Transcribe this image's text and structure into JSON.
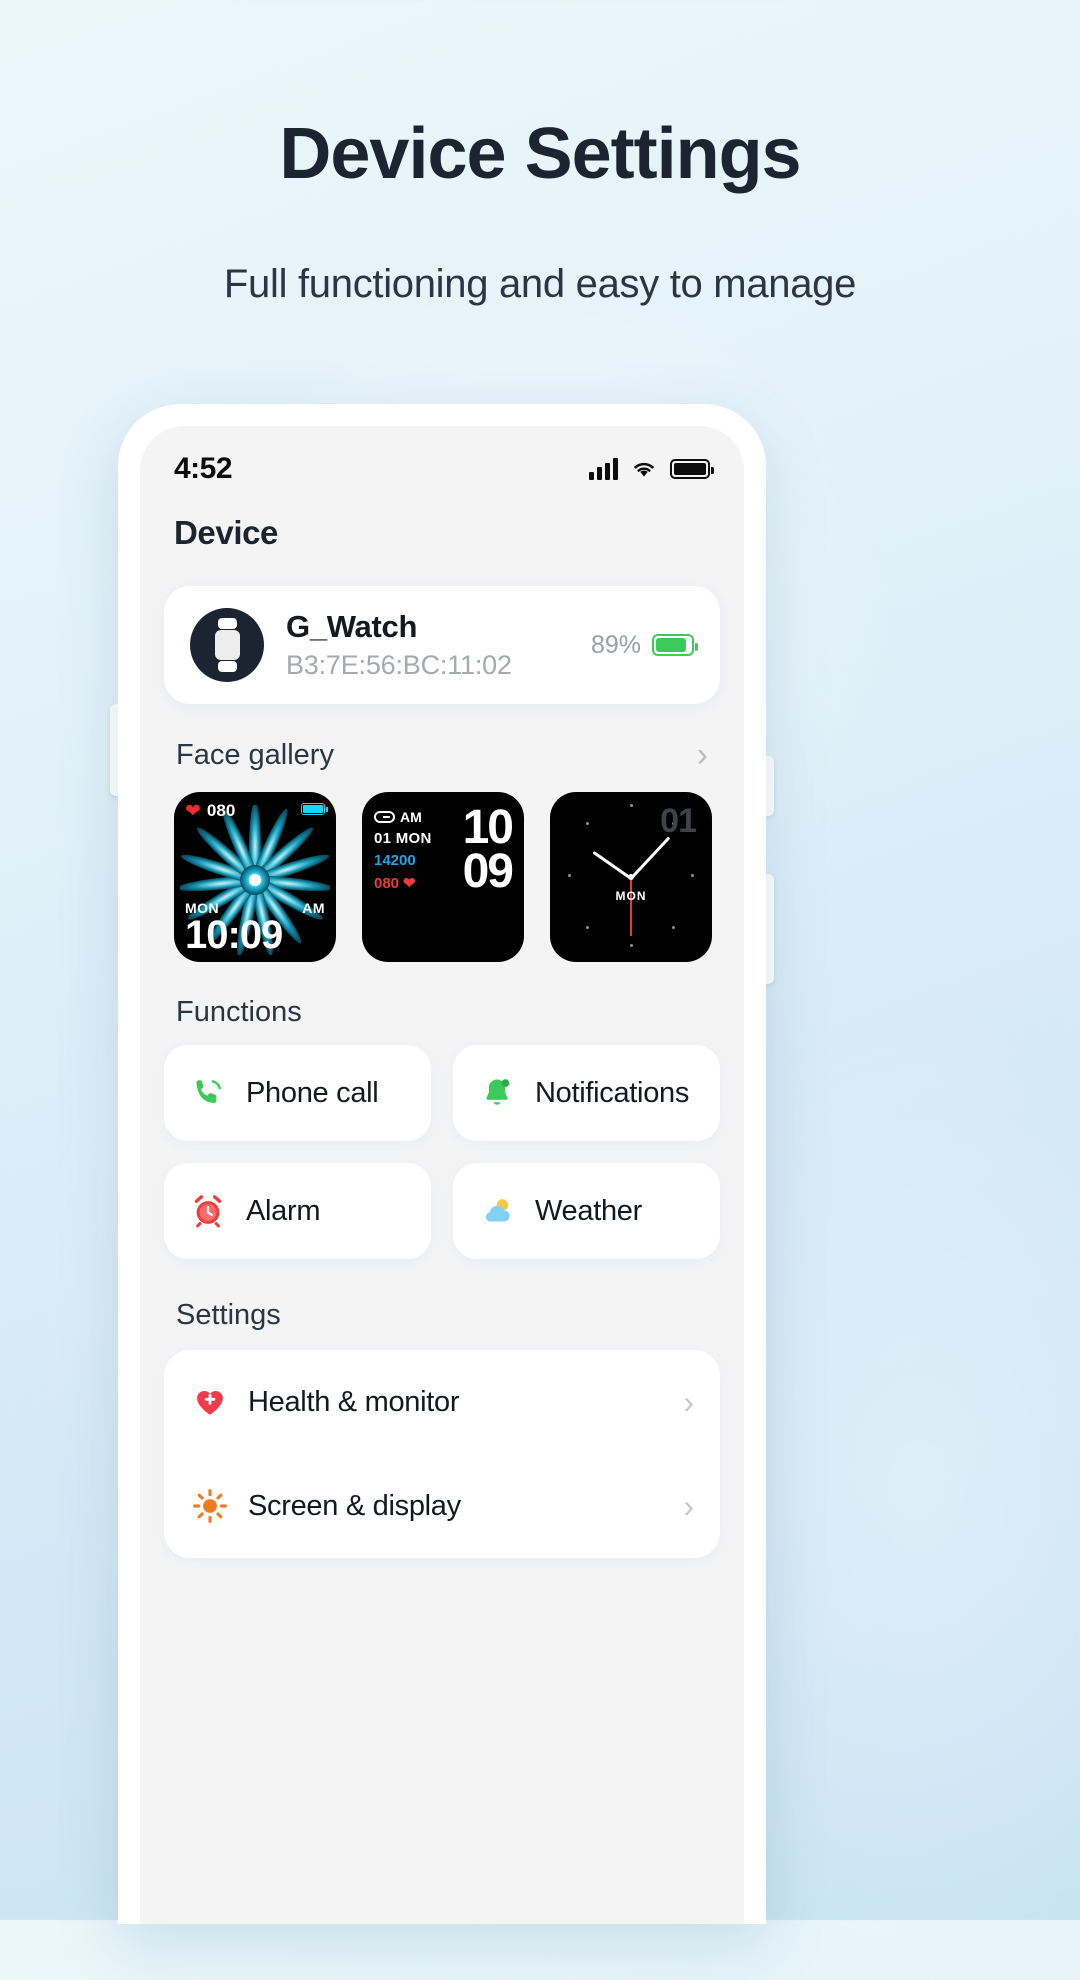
{
  "hero": {
    "title": "Device Settings",
    "subtitle": "Full functioning and easy to manage"
  },
  "statusbar": {
    "time": "4:52",
    "signal_icon": "cellular-signal-icon",
    "wifi_icon": "wifi-icon",
    "battery_icon": "battery-full-icon"
  },
  "sections": {
    "device_title": "Device",
    "face_gallery_title": "Face gallery",
    "functions_title": "Functions",
    "settings_title": "Settings"
  },
  "device": {
    "name": "G_Watch",
    "mac": "B3:7E:56:BC:11:02",
    "battery_percent": "89%",
    "avatar_icon": "smartwatch-icon",
    "battery_color": "#3ccb5a"
  },
  "face_gallery": {
    "chevron_icon": "chevron-right-icon",
    "faces": [
      {
        "name": "flower-face",
        "heart_icon": "heart-icon",
        "heart_rate": "080",
        "battery_icon": "battery-icon",
        "weekday": "MON",
        "meridiem": "AM",
        "time": "10:09",
        "accent": "#13d7f5"
      },
      {
        "name": "digital-face",
        "link_icon": "link-icon",
        "meridiem": "AM",
        "date": "01 MON",
        "steps": "14200",
        "heart_rate": "080",
        "heart_icon": "heart-icon",
        "hours": "10",
        "minutes": "09",
        "steps_color": "#19a7e8",
        "hr_color": "#ef3b3b"
      },
      {
        "name": "analog-face",
        "date": "01",
        "weekday": "MON",
        "second_hand_color": "#e23b3b"
      }
    ]
  },
  "functions": [
    {
      "label": "Phone call",
      "icon": "phone-icon",
      "color": "#3ccb5a"
    },
    {
      "label": "Notifications",
      "icon": "bell-icon",
      "color": "#3ccb5a"
    },
    {
      "label": "Alarm",
      "icon": "alarm-clock-icon",
      "color": "#ef3b3b"
    },
    {
      "label": "Weather",
      "icon": "weather-cloud-sun-icon",
      "color": "#5cc3f0"
    }
  ],
  "settings": [
    {
      "label": "Health & monitor",
      "icon": "heart-plus-icon",
      "color": "#ef3b4a",
      "chevron": "chevron-right-icon"
    },
    {
      "label": "Screen & display",
      "icon": "brightness-icon",
      "color": "#f07a1e",
      "chevron": "chevron-right-icon"
    }
  ]
}
